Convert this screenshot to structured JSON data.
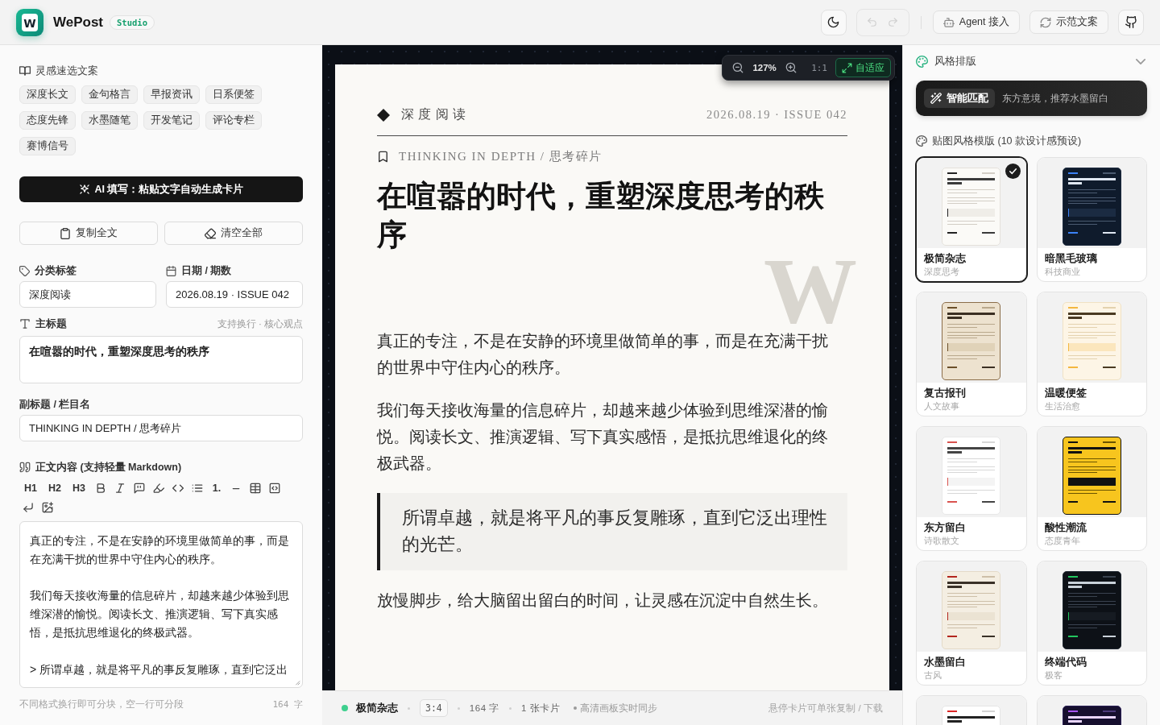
{
  "app": {
    "logo_letter": "W",
    "name": "WePost",
    "badge": "Studio"
  },
  "toolbar": {
    "undo": {
      "disabled": true
    },
    "redo": {
      "disabled": true
    },
    "agent_button": "Agent 接入",
    "demo_button": "示范文案"
  },
  "left": {
    "presets": {
      "title": "灵感速选文案",
      "chips": [
        "深度长文",
        "金句格言",
        "早报资讯",
        "日系便签",
        "态度先锋",
        "水墨随笔",
        "开发笔记",
        "评论专栏",
        "赛博信号"
      ]
    },
    "ai_button": "AI 填写：粘贴文字自动生成卡片",
    "copy_button": "复制全文",
    "clear_button": "清空全部",
    "category": {
      "label": "分类标签",
      "value": "深度阅读"
    },
    "date": {
      "label": "日期 / 期数",
      "value": "2026.08.19 · ISSUE 042"
    },
    "title": {
      "label": "主标题",
      "hint": "支持换行 · 核心观点",
      "value": "在喧嚣的时代，重塑深度思考的秩序"
    },
    "subtitle": {
      "label": "副标题 / 栏目名",
      "value": "THINKING IN DEPTH / 思考碎片"
    },
    "body": {
      "label": "正文内容 (支持轻量 Markdown)",
      "headings": [
        "H1",
        "H2",
        "H3"
      ],
      "numbered_list": "1.",
      "paragraphs": [
        "真正的专注，不是在安静的环境里做简单的事，而是在充满干扰的世界中守住内心的秩序。",
        "我们每天接收海量的信息碎片，却越来越少体验到思维深潜的愉悦。阅读长文、推演逻辑、写下真实感悟，是抵抗思维退化的终极武器。",
        "> 所谓卓越，就是将平凡的事反复雕琢，直到它泛出"
      ],
      "hint": "不同格式换行即可分块，空一行可分段",
      "count": "164 字"
    }
  },
  "preview": {
    "zoom": {
      "level": "127%",
      "actual_size": "1:1",
      "fit": {
        "label": "自适应",
        "selected": true
      }
    },
    "card": {
      "category": "深度阅读",
      "date": "2026.08.19 · ISSUE 042",
      "subtitle": "THINKING IN DEPTH / 思考碎片",
      "title": "在喧嚣的时代，重塑深度思考的秩序",
      "monogram": "W",
      "blocks": [
        {
          "kind": "paragraph",
          "text": "真正的专注，不是在安静的环境里做简单的事，而是在充满干扰的世界中守住内心的秩序。"
        },
        {
          "kind": "paragraph",
          "text": "我们每天接收海量的信息碎片，却越来越少体验到思维深潜的愉悦。阅读长文、推演逻辑、写下真实感悟，是抵抗思维退化的终极武器。"
        },
        {
          "kind": "quote",
          "text": "所谓卓越，就是将平凡的事反复雕琢，直到它泛出理性的光芒。"
        },
        {
          "kind": "paragraph",
          "text": "放慢脚步，给大脑留出留白的时间，让灵感在沉淀中自然生长。"
        }
      ]
    },
    "status": {
      "template": "极简杂志",
      "ratio": "3:4",
      "count": "164 字",
      "cards": "1 张卡片",
      "sync": "高清画板实时同步",
      "hint": "悬停卡片可单张复制 / 下载"
    }
  },
  "right": {
    "title": "风格排版",
    "smart_match": {
      "label": "智能匹配",
      "text": "东方意境，推荐水墨留白"
    },
    "templates_title": "贴图风格模版 (10 款设计感预设)",
    "templates": [
      {
        "name": "极简杂志",
        "tag": "深度思考",
        "kind": "minimal",
        "selected": true
      },
      {
        "name": "暗黑毛玻璃",
        "tag": "科技商业",
        "kind": "glass",
        "selected": false
      },
      {
        "name": "复古报刊",
        "tag": "人文故事",
        "kind": "retro",
        "selected": false
      },
      {
        "name": "温暖便签",
        "tag": "生活治愈",
        "kind": "warm",
        "selected": false
      },
      {
        "name": "东方留白",
        "tag": "诗歌散文",
        "kind": "oriental",
        "selected": false
      },
      {
        "name": "酸性潮流",
        "tag": "态度青年",
        "kind": "acid",
        "selected": false
      },
      {
        "name": "水墨留白",
        "tag": "古风",
        "kind": "ink",
        "selected": false
      },
      {
        "name": "终端代码",
        "tag": "极客",
        "kind": "terminal",
        "selected": false
      },
      {
        "kind": "news",
        "selected": false
      },
      {
        "kind": "neon",
        "selected": false
      }
    ]
  }
}
